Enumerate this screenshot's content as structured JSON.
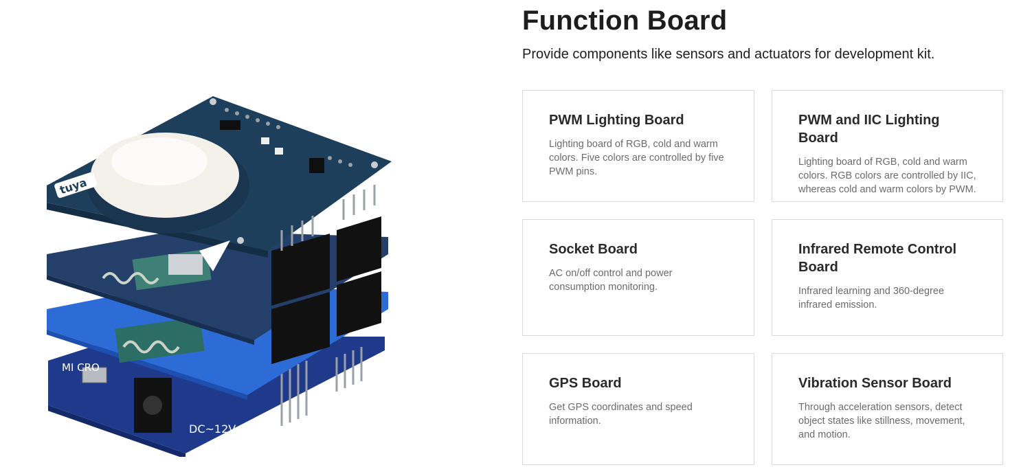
{
  "header": {
    "title": "Function Board",
    "subtitle": "Provide components like sensors and actuators for development kit."
  },
  "image": {
    "brand": "tuya",
    "silk_dc": "DC~12V",
    "silk_micro": "MI CRO"
  },
  "cards": [
    {
      "title": "PWM Lighting Board",
      "desc": "Lighting board of RGB, cold and warm colors. Five colors are controlled by five PWM pins."
    },
    {
      "title": "PWM and IIC Lighting Board",
      "desc": "Lighting board of RGB, cold and warm colors. RGB colors are controlled by IIC, whereas cold and warm colors by PWM."
    },
    {
      "title": "Socket Board",
      "desc": "AC on/off control and power consumption monitoring."
    },
    {
      "title": "Infrared Remote Control Board",
      "desc": "Infrared learning and 360-degree infrared emission."
    },
    {
      "title": "GPS Board",
      "desc": "Get GPS coordinates and speed information."
    },
    {
      "title": "Vibration Sensor Board",
      "desc": "Through acceleration sensors, detect object states like stillness, movement, and motion."
    }
  ]
}
